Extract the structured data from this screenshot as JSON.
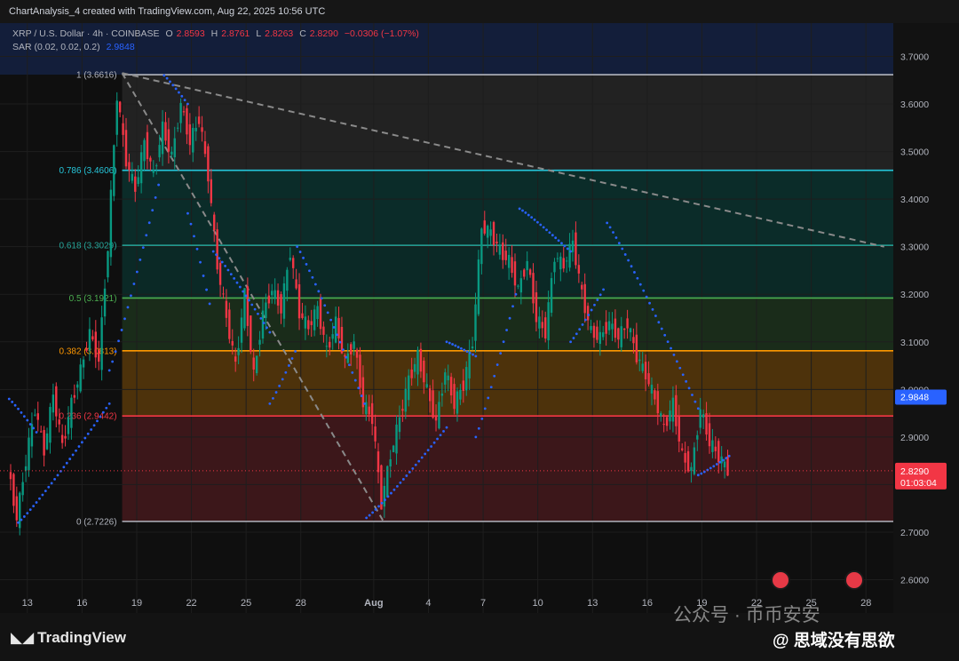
{
  "header": {
    "credit": "ChartAnalysis_4 created with TradingView.com, Aug 22, 2025 10:56 UTC"
  },
  "legend": {
    "symbol": "XRP / U.S. Dollar · 4h · COINBASE",
    "open_label": "O",
    "open": "2.8593",
    "high_label": "H",
    "high": "2.8761",
    "low_label": "L",
    "low": "2.8263",
    "close_label": "C",
    "close": "2.8290",
    "change": "−0.0306 (−1.07%)",
    "sar_label": "SAR (0.02, 0.02, 0.2)",
    "sar_value": "2.9848"
  },
  "chart_data": {
    "type": "candlestick",
    "symbol": "XRP / U.S. Dollar",
    "timeframe": "4h",
    "exchange": "COINBASE",
    "ylim": [
      2.53,
      3.77
    ],
    "y_ticks": [
      "3.7000",
      "3.6000",
      "3.5000",
      "3.4000",
      "3.3000",
      "3.2000",
      "3.1000",
      "3.0000",
      "2.9000",
      "2.8000",
      "2.7000",
      "2.6000"
    ],
    "x_ticks": [
      {
        "label": "13",
        "day": 13
      },
      {
        "label": "16",
        "day": 16
      },
      {
        "label": "19",
        "day": 19
      },
      {
        "label": "22",
        "day": 22
      },
      {
        "label": "25",
        "day": 25
      },
      {
        "label": "28",
        "day": 28
      },
      {
        "label": "Aug",
        "day": 32
      },
      {
        "label": "4",
        "day": 35
      },
      {
        "label": "7",
        "day": 38
      },
      {
        "label": "10",
        "day": 41
      },
      {
        "label": "13",
        "day": 44
      },
      {
        "label": "16",
        "day": 47
      },
      {
        "label": "19",
        "day": 50
      },
      {
        "label": "22",
        "day": 53
      },
      {
        "label": "25",
        "day": 56
      },
      {
        "label": "28",
        "day": 59
      }
    ],
    "fib_levels": [
      {
        "label": "1 (3.6616)",
        "value": 3.6616,
        "color": "#b2b5be"
      },
      {
        "label": "0.786 (3.4606)",
        "value": 3.4606,
        "color": "#26c6da"
      },
      {
        "label": "0.618 (3.3029)",
        "value": 3.3029,
        "color": "#26a69a"
      },
      {
        "label": "0.5 (3.1921)",
        "value": 3.1921,
        "color": "#4caf50"
      },
      {
        "label": "0.382 (3.0813)",
        "value": 3.0813,
        "color": "#ff9800"
      },
      {
        "label": "0.236 (2.9442)",
        "value": 2.9442,
        "color": "#f23645"
      },
      {
        "label": "0 (2.7226)",
        "value": 2.7226,
        "color": "#b2b5be"
      }
    ],
    "price_badges": [
      {
        "text": "2.9848",
        "value": 2.9848,
        "color": "#2962ff"
      },
      {
        "text": "2.8290",
        "value": 2.829,
        "color": "#f23645",
        "sub": "01:03:04"
      }
    ],
    "trendlines": [
      {
        "from": [
          18.2,
          3.665
        ],
        "to": [
          60,
          3.3
        ]
      },
      {
        "from": [
          18.2,
          3.665
        ],
        "to": [
          32.5,
          2.725
        ]
      }
    ],
    "candles": [
      [
        12,
        2.84
      ],
      [
        12.5,
        2.73
      ],
      [
        13,
        2.85
      ],
      [
        13.5,
        2.96
      ],
      [
        14,
        2.87
      ],
      [
        14.5,
        2.99
      ],
      [
        15,
        2.88
      ],
      [
        15.5,
        2.97
      ],
      [
        16,
        3.04
      ],
      [
        16.5,
        3.12
      ],
      [
        17,
        3.06
      ],
      [
        17.5,
        3.3
      ],
      [
        18,
        3.62
      ],
      [
        18.5,
        3.48
      ],
      [
        19,
        3.42
      ],
      [
        19.5,
        3.52
      ],
      [
        20,
        3.45
      ],
      [
        20.5,
        3.55
      ],
      [
        21,
        3.49
      ],
      [
        21.5,
        3.6
      ],
      [
        22,
        3.52
      ],
      [
        22.5,
        3.57
      ],
      [
        23,
        3.45
      ],
      [
        23.5,
        3.26
      ],
      [
        24,
        3.15
      ],
      [
        24.5,
        3.05
      ],
      [
        25,
        3.2
      ],
      [
        25.5,
        3.03
      ],
      [
        26,
        3.16
      ],
      [
        26.5,
        3.21
      ],
      [
        27,
        3.17
      ],
      [
        27.5,
        3.29
      ],
      [
        28,
        3.16
      ],
      [
        28.5,
        3.13
      ],
      [
        29,
        3.17
      ],
      [
        29.5,
        3.08
      ],
      [
        30,
        3.14
      ],
      [
        30.5,
        3.06
      ],
      [
        31,
        3.1
      ],
      [
        31.5,
        2.97
      ],
      [
        32,
        2.94
      ],
      [
        32.5,
        2.76
      ],
      [
        33,
        2.86
      ],
      [
        33.5,
        2.94
      ],
      [
        34,
        3.02
      ],
      [
        34.5,
        3.07
      ],
      [
        35,
        3.0
      ],
      [
        35.5,
        2.93
      ],
      [
        36,
        3.04
      ],
      [
        36.5,
        2.97
      ],
      [
        37,
        3.01
      ],
      [
        37.5,
        3.1
      ],
      [
        38,
        3.34
      ],
      [
        38.5,
        3.33
      ],
      [
        39,
        3.29
      ],
      [
        39.5,
        3.27
      ],
      [
        40,
        3.21
      ],
      [
        40.5,
        3.27
      ],
      [
        41,
        3.15
      ],
      [
        41.5,
        3.12
      ],
      [
        42,
        3.28
      ],
      [
        42.5,
        3.26
      ],
      [
        43,
        3.31
      ],
      [
        43.5,
        3.2
      ],
      [
        44,
        3.12
      ],
      [
        44.5,
        3.11
      ],
      [
        45,
        3.14
      ],
      [
        45.5,
        3.11
      ],
      [
        46,
        3.14
      ],
      [
        46.5,
        3.07
      ],
      [
        47,
        3.03
      ],
      [
        47.5,
        2.98
      ],
      [
        48,
        2.92
      ],
      [
        48.5,
        2.97
      ],
      [
        49,
        2.86
      ],
      [
        49.5,
        2.83
      ],
      [
        50,
        2.96
      ],
      [
        50.5,
        2.89
      ],
      [
        51,
        2.86
      ],
      [
        51.5,
        2.83
      ]
    ],
    "sar_segments": [
      {
        "from": [
          12,
          2.98
        ],
        "to": [
          13.5,
          2.91
        ],
        "side": "above"
      },
      {
        "from": [
          12.5,
          2.72
        ],
        "to": [
          17.5,
          2.97
        ],
        "side": "below"
      },
      {
        "from": [
          17.5,
          3.04
        ],
        "to": [
          20.2,
          3.43
        ],
        "side": "below"
      },
      {
        "from": [
          20.5,
          3.66
        ],
        "to": [
          21.8,
          3.6
        ],
        "side": "above"
      },
      {
        "from": [
          21.8,
          3.37
        ],
        "to": [
          23.0,
          3.18
        ],
        "side": "below"
      },
      {
        "from": [
          23.2,
          3.29
        ],
        "to": [
          26.3,
          3.12
        ],
        "side": "above"
      },
      {
        "from": [
          26.3,
          2.97
        ],
        "to": [
          27.7,
          3.08
        ],
        "side": "below"
      },
      {
        "from": [
          27.8,
          3.3
        ],
        "to": [
          31.5,
          2.97
        ],
        "side": "above"
      },
      {
        "from": [
          31.6,
          2.73
        ],
        "to": [
          36.0,
          2.92
        ],
        "side": "below"
      },
      {
        "from": [
          36.0,
          3.1
        ],
        "to": [
          37.6,
          3.07
        ],
        "side": "above"
      },
      {
        "from": [
          37.6,
          2.9
        ],
        "to": [
          39.8,
          3.2
        ],
        "side": "below"
      },
      {
        "from": [
          40.0,
          3.38
        ],
        "to": [
          42.8,
          3.29
        ],
        "side": "above"
      },
      {
        "from": [
          42.8,
          3.1
        ],
        "to": [
          44.6,
          3.21
        ],
        "side": "below"
      },
      {
        "from": [
          44.8,
          3.35
        ],
        "to": [
          49.8,
          2.96
        ],
        "side": "above"
      },
      {
        "from": [
          49.8,
          2.82
        ],
        "to": [
          51.5,
          2.86
        ],
        "side": "below"
      }
    ]
  },
  "watermark": {
    "brand": "TradingView",
    "channel": "公众号 · 币币安安",
    "author": "@ 思域没有思欲"
  }
}
